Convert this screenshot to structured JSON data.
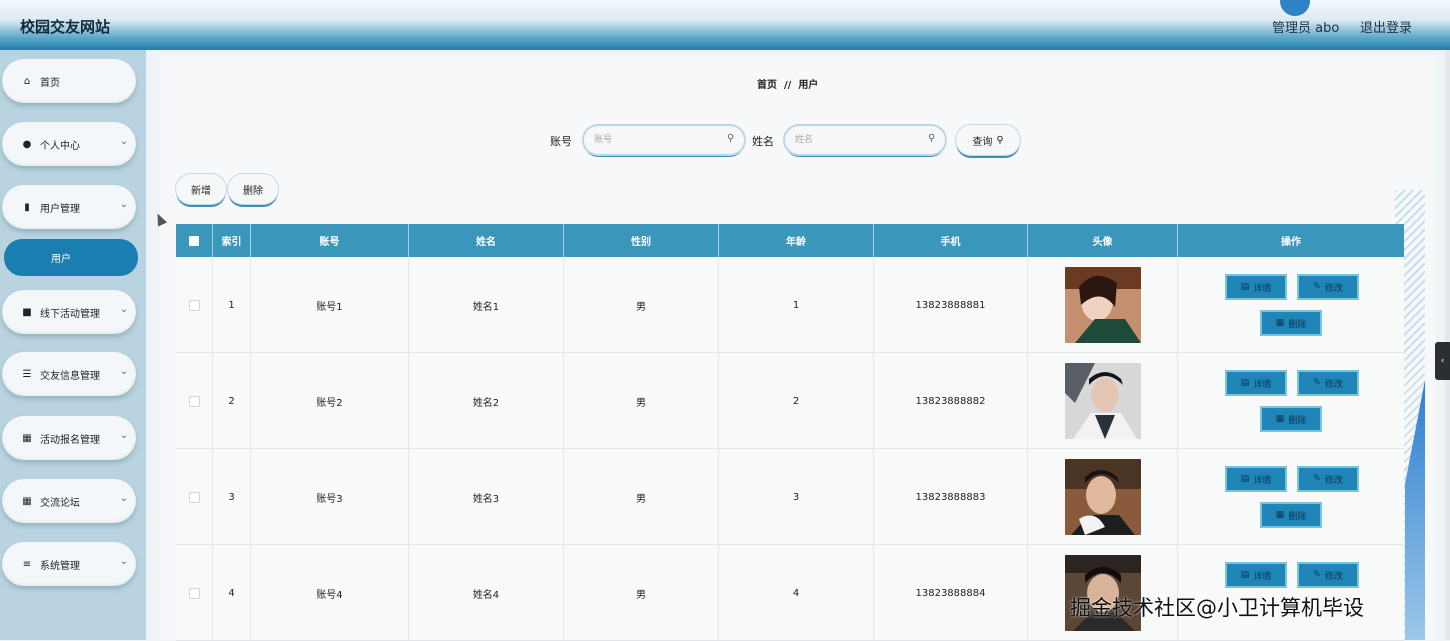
{
  "header": {
    "site_title": "校园交友网站",
    "admin_label": "管理员 abo",
    "logout_label": "退出登录"
  },
  "sidebar": {
    "items": [
      {
        "label": "首页",
        "icon": "home-icon",
        "has_chevron": false
      },
      {
        "label": "个人中心",
        "icon": "user-icon",
        "has_chevron": true
      },
      {
        "label": "用户管理",
        "icon": "clipboard-icon",
        "has_chevron": true
      },
      {
        "label": "线下活动管理",
        "icon": "briefcase-icon",
        "has_chevron": true
      },
      {
        "label": "交友信息管理",
        "icon": "list-icon",
        "has_chevron": true
      },
      {
        "label": "活动报名管理",
        "icon": "grid-icon",
        "has_chevron": true
      },
      {
        "label": "交流论坛",
        "icon": "grid-icon",
        "has_chevron": true
      },
      {
        "label": "系统管理",
        "icon": "sliders-icon",
        "has_chevron": true
      }
    ],
    "sub_active": "用户"
  },
  "breadcrumb": {
    "home": "首页",
    "separator": "//",
    "current": "用户"
  },
  "search": {
    "account_label": "账号",
    "account_placeholder": "账号",
    "name_label": "姓名",
    "name_placeholder": "姓名",
    "query_label": "查询"
  },
  "toolbar": {
    "add_label": "新增",
    "delete_label": "删除"
  },
  "table": {
    "columns": [
      "索引",
      "账号",
      "姓名",
      "性别",
      "年龄",
      "手机",
      "头像",
      "操作"
    ],
    "rows": [
      {
        "index": "1",
        "account": "账号1",
        "name": "姓名1",
        "gender": "男",
        "age": "1",
        "phone": "13823888881"
      },
      {
        "index": "2",
        "account": "账号2",
        "name": "姓名2",
        "gender": "男",
        "age": "2",
        "phone": "13823888882"
      },
      {
        "index": "3",
        "account": "账号3",
        "name": "姓名3",
        "gender": "男",
        "age": "3",
        "phone": "13823888883"
      },
      {
        "index": "4",
        "account": "账号4",
        "name": "姓名4",
        "gender": "男",
        "age": "4",
        "phone": "13823888884"
      }
    ],
    "actions": {
      "detail": "详情",
      "edit": "修改",
      "delete": "删除"
    }
  },
  "watermark": "掘金技术社区@小卫计算机毕设",
  "colors": {
    "accent": "#3a96ba",
    "active_menu": "#1a7fb0",
    "action_button": "#1f84b6"
  }
}
